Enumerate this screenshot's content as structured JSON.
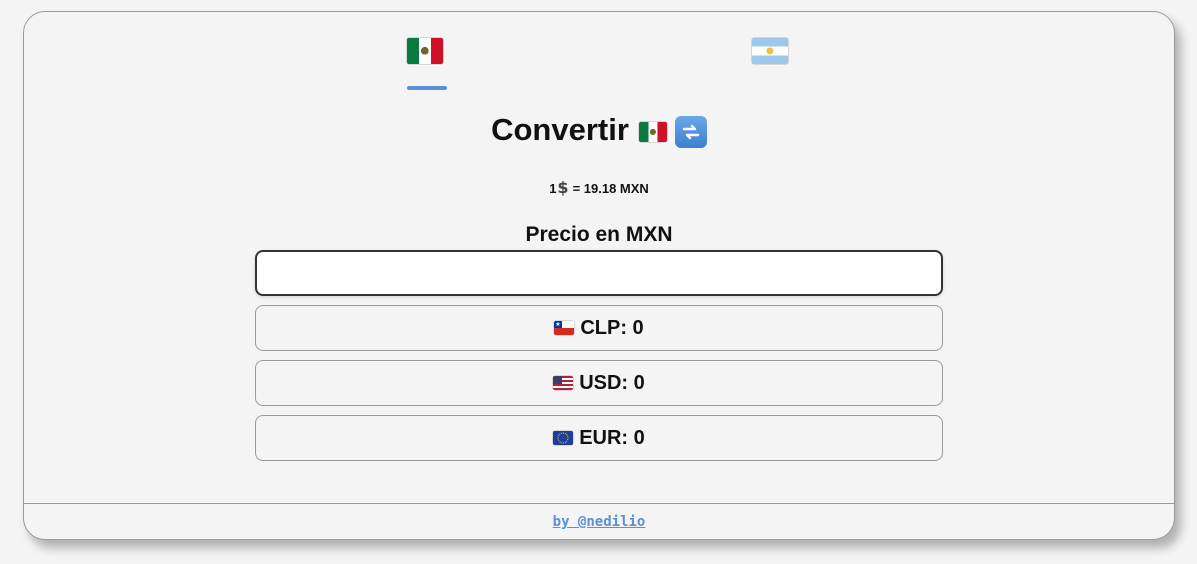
{
  "tabs": [
    {
      "icon": "mexico-flag-icon",
      "active": true
    },
    {
      "icon": "argentina-flag-icon",
      "active": false
    }
  ],
  "title": {
    "text": "Convertir",
    "flag_icon": "mexico-flag-icon",
    "swap_icon": "swap-arrows-icon"
  },
  "rate": {
    "prefix": "1",
    "currency_icon": "dollar-icon",
    "text": "= 19.18 MXN"
  },
  "input": {
    "label": "Precio en MXN",
    "value": "",
    "placeholder": ""
  },
  "results": [
    {
      "flag_icon": "chile-flag-icon",
      "text": "CLP: 0"
    },
    {
      "flag_icon": "usa-flag-icon",
      "text": "USD: 0"
    },
    {
      "flag_icon": "eu-flag-icon",
      "text": "EUR: 0"
    }
  ],
  "footer": {
    "link_text": "by @nedilio"
  },
  "colors": {
    "accent": "#5b8fd6",
    "background": "#f4f4f4",
    "border": "#9a9a9a"
  }
}
